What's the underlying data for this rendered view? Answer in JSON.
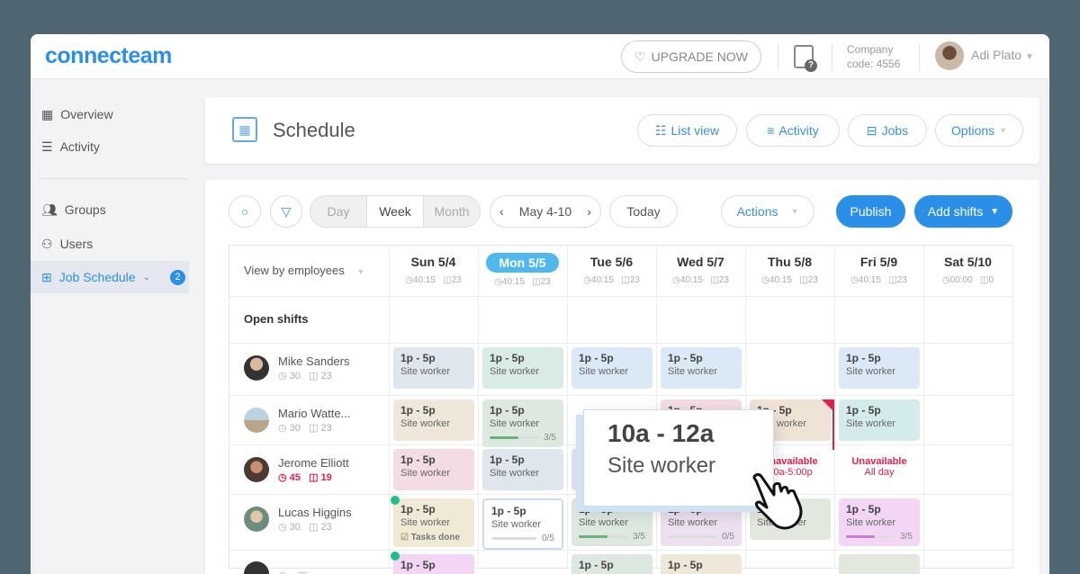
{
  "app": {
    "logo": "connecteam",
    "upgrade": "UPGRADE NOW",
    "company_line1": "Company",
    "company_line2": "code: 4556",
    "user": "Adi Plato"
  },
  "sidebar": {
    "items": [
      {
        "label": "Overview"
      },
      {
        "label": "Activity"
      },
      {
        "label": "Groups"
      },
      {
        "label": "Users"
      },
      {
        "label": "Job Schedule",
        "badge": "2"
      }
    ]
  },
  "header": {
    "title": "Schedule",
    "list_view": "List view",
    "activity": "Activity",
    "jobs": "Jobs",
    "options": "Options"
  },
  "toolbar": {
    "views": [
      "Day",
      "Week",
      "Month"
    ],
    "selected_view": "Week",
    "range": "May 4-10",
    "today": "Today",
    "actions": "Actions",
    "publish": "Publish",
    "add_shifts": "Add shifts"
  },
  "grid": {
    "view_by": "View by employees",
    "open_shifts": "Open shifts",
    "days": [
      {
        "label": "Sun 5/4",
        "hours": "40:15",
        "shifts": "23"
      },
      {
        "label": "Mon 5/5",
        "hours": "40:15",
        "shifts": "23",
        "today": true
      },
      {
        "label": "Tue 5/6",
        "hours": "40:15",
        "shifts": "23"
      },
      {
        "label": "Wed 5/7",
        "hours": "40:15",
        "shifts": "23"
      },
      {
        "label": "Thu 5/8",
        "hours": "40:15",
        "shifts": "23"
      },
      {
        "label": "Fri 5/9",
        "hours": "40:15",
        "shifts": "23"
      },
      {
        "label": "Sat 5/10",
        "hours": "00:00",
        "shifts": "0"
      }
    ],
    "employees": [
      {
        "name": "Mike Sanders",
        "hours": "30",
        "shifts": "23",
        "cells": [
          {
            "time": "1p - 5p",
            "role": "Site worker",
            "color": "#dfe6ee"
          },
          {
            "time": "1p - 5p",
            "role": "Site worker",
            "color": "#d9ece3"
          },
          {
            "time": "1p - 5p",
            "role": "Site worker",
            "color": "#dbe9f7"
          },
          {
            "time": "1p - 5p",
            "role": "Site worker",
            "color": "#dbe9f7"
          },
          null,
          {
            "time": "1p - 5p",
            "role": "Site worker",
            "color": "#dbe9f7"
          },
          null
        ]
      },
      {
        "name": "Mario Watte...",
        "hours": "30",
        "shifts": "23",
        "cells": [
          {
            "time": "1p - 5p",
            "role": "Site worker",
            "color": "#efe7da"
          },
          {
            "time": "1p - 5p",
            "role": "Site worker",
            "color": "#dde9e0",
            "progress": "3/5",
            "fill": 0.6,
            "bar": "#6cb07a"
          },
          null,
          {
            "time": "1p - 5p",
            "role": "Site worker",
            "color": "#f4dde3"
          },
          {
            "time": "1p - 5p",
            "role": "Site worker",
            "color": "#efe3d6",
            "flag": true
          },
          {
            "time": "1p - 5p",
            "role": "Site worker",
            "color": "#d4ebeb"
          },
          null
        ]
      },
      {
        "name": "Jerome Elliott",
        "hours": "45",
        "shifts": "19",
        "alert": true,
        "cells": [
          {
            "time": "1p - 5p",
            "role": "Site worker",
            "color": "#f4dde2"
          },
          {
            "time": "1p - 5p",
            "role": "Site worker",
            "color": "#dfe6ee"
          },
          {
            "time": "1p - 5p",
            "role": "Site worker",
            "color": "#e3e1ec"
          },
          null,
          {
            "unavailable": "Unavailable",
            "when": "10a-5:00p"
          },
          {
            "unavailable": "Unavailable",
            "when": "All day"
          },
          null
        ]
      },
      {
        "name": "Lucas Higgins",
        "hours": "30",
        "shifts": "23",
        "cells": [
          {
            "time": "1p - 5p",
            "role": "Site worker",
            "color": "#efe9d6",
            "dot": true,
            "tasks": "Tasks done"
          },
          {
            "time": "1p - 5p",
            "role": "Site worker",
            "color": "#ffffff",
            "border": "#c9dcef",
            "progress": "0/5",
            "fill": 0,
            "bar": "#ccc"
          },
          {
            "time": "1p - 5p",
            "role": "Site worker",
            "color": "#dde9e0",
            "progress": "3/5",
            "fill": 0.6,
            "bar": "#6cb07a"
          },
          {
            "time": "1p - 5p",
            "role": "Site worker",
            "color": "#ebdff0",
            "progress": "0/5",
            "fill": 0,
            "bar": "#ccc"
          },
          {
            "time": "1p - 5p",
            "role": "Site worker",
            "color": "#e3e8df"
          },
          {
            "time": "1p - 5p",
            "role": "Site worker",
            "color": "#f2d6f4",
            "progress": "3/5",
            "fill": 0.6,
            "bar": "#c77fd0"
          },
          null
        ]
      },
      {
        "name": "",
        "hours": "",
        "shifts": "",
        "cells": [
          {
            "time": "1p - 5p",
            "role": "",
            "color": "#f2d6f4",
            "dot": true
          },
          null,
          {
            "time": "1p - 5p",
            "role": "",
            "color": "#dde9e0"
          },
          {
            "time": "1p - 5p",
            "role": "",
            "color": "#efe7da"
          },
          null,
          {
            "time": "",
            "role": "",
            "color": "#e3e8df"
          },
          null
        ]
      }
    ]
  },
  "tooltip": {
    "time": "10a - 12a",
    "role": "Site worker"
  },
  "colors": {
    "accent": "#2a8fe6",
    "today": "#4fb8ec",
    "alert": "#e0234c",
    "background": "#4f6571"
  }
}
